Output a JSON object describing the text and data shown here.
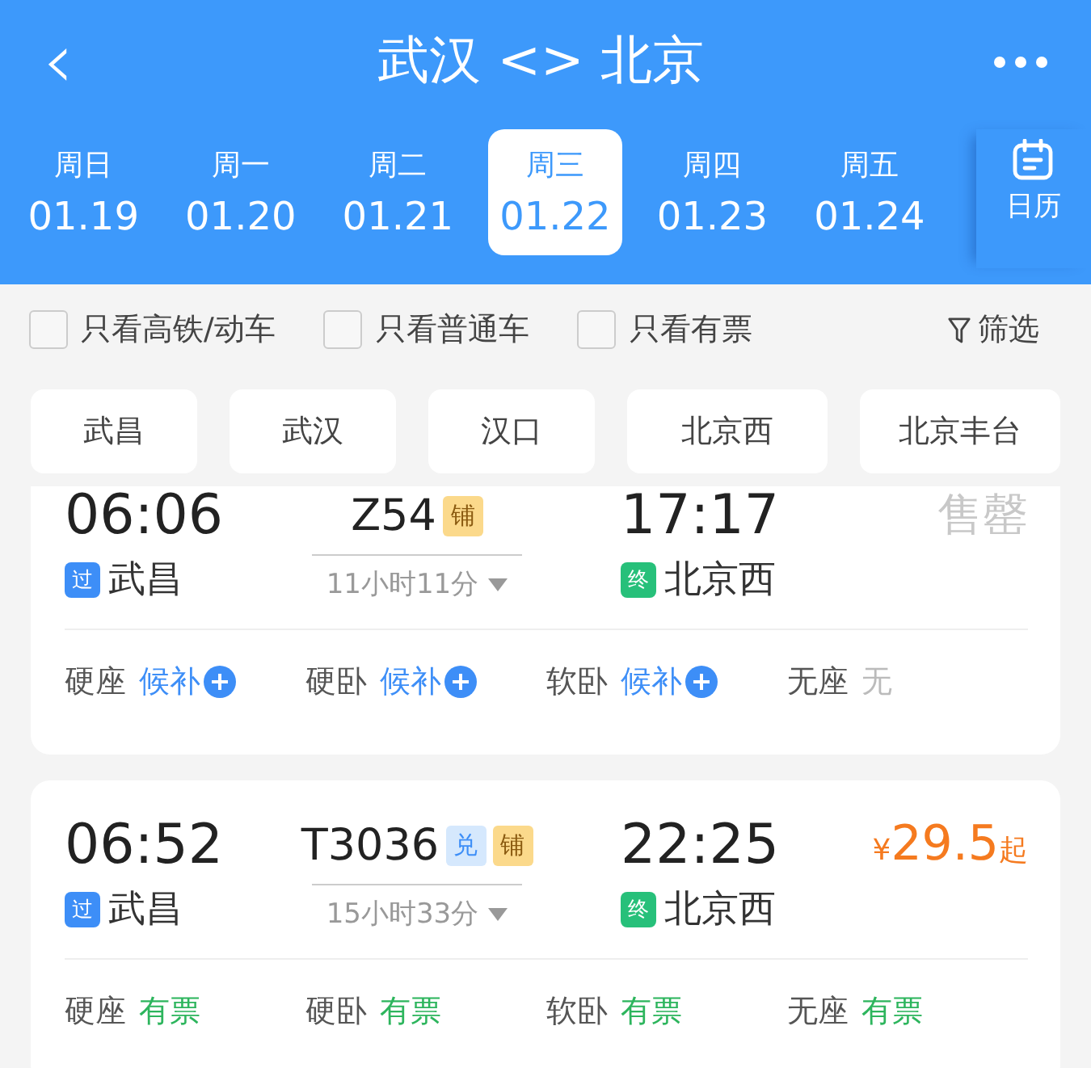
{
  "header": {
    "title": "武汉 <> 北京",
    "back": "‹"
  },
  "dates": [
    {
      "weekday": "周日",
      "date": "01.19",
      "selected": false
    },
    {
      "weekday": "周一",
      "date": "01.20",
      "selected": false
    },
    {
      "weekday": "周二",
      "date": "01.21",
      "selected": false
    },
    {
      "weekday": "周三",
      "date": "01.22",
      "selected": true
    },
    {
      "weekday": "周四",
      "date": "01.23",
      "selected": false
    },
    {
      "weekday": "周五",
      "date": "01.24",
      "selected": false
    }
  ],
  "calendar_label": "日历",
  "filters": [
    {
      "label": "只看高铁/动车",
      "checked": false
    },
    {
      "label": "只看普通车",
      "checked": false
    },
    {
      "label": "只看有票",
      "checked": false
    }
  ],
  "filter_button": "筛选",
  "stations": [
    {
      "label": "武昌",
      "selected": false
    },
    {
      "label": "武汉",
      "selected": false
    },
    {
      "label": "汉口",
      "selected": false
    },
    {
      "label": "北京西",
      "selected": false
    },
    {
      "label": "北京丰台",
      "selected": false
    }
  ],
  "trains": [
    {
      "depart": "06:06",
      "arrive": "17:17",
      "number": "Z54",
      "tags": [
        {
          "label": "铺",
          "kind": "berth"
        }
      ],
      "duration": "11小时11分",
      "from_tag": "过",
      "from": "武昌",
      "to_tag": "终",
      "to": "北京西",
      "sold_out": "售罄",
      "seats": [
        {
          "name": "硬座",
          "status": "候补",
          "kind": "waitlist"
        },
        {
          "name": "硬卧",
          "status": "候补",
          "kind": "waitlist"
        },
        {
          "name": "软卧",
          "status": "候补",
          "kind": "waitlist"
        },
        {
          "name": "无座",
          "status": "无",
          "kind": "none"
        }
      ]
    },
    {
      "depart": "06:52",
      "arrive": "22:25",
      "number": "T3036",
      "tags": [
        {
          "label": "兑",
          "kind": "exchange"
        },
        {
          "label": "铺",
          "kind": "berth"
        }
      ],
      "duration": "15小时33分",
      "from_tag": "过",
      "from": "武昌",
      "to_tag": "终",
      "to": "北京西",
      "price": {
        "currency": "¥",
        "amount": "29.5",
        "suffix": "起"
      },
      "seats": [
        {
          "name": "硬座",
          "status": "有票",
          "kind": "available"
        },
        {
          "name": "硬卧",
          "status": "有票",
          "kind": "available"
        },
        {
          "name": "软卧",
          "status": "有票",
          "kind": "available"
        },
        {
          "name": "无座",
          "status": "有票",
          "kind": "available"
        }
      ]
    }
  ]
}
